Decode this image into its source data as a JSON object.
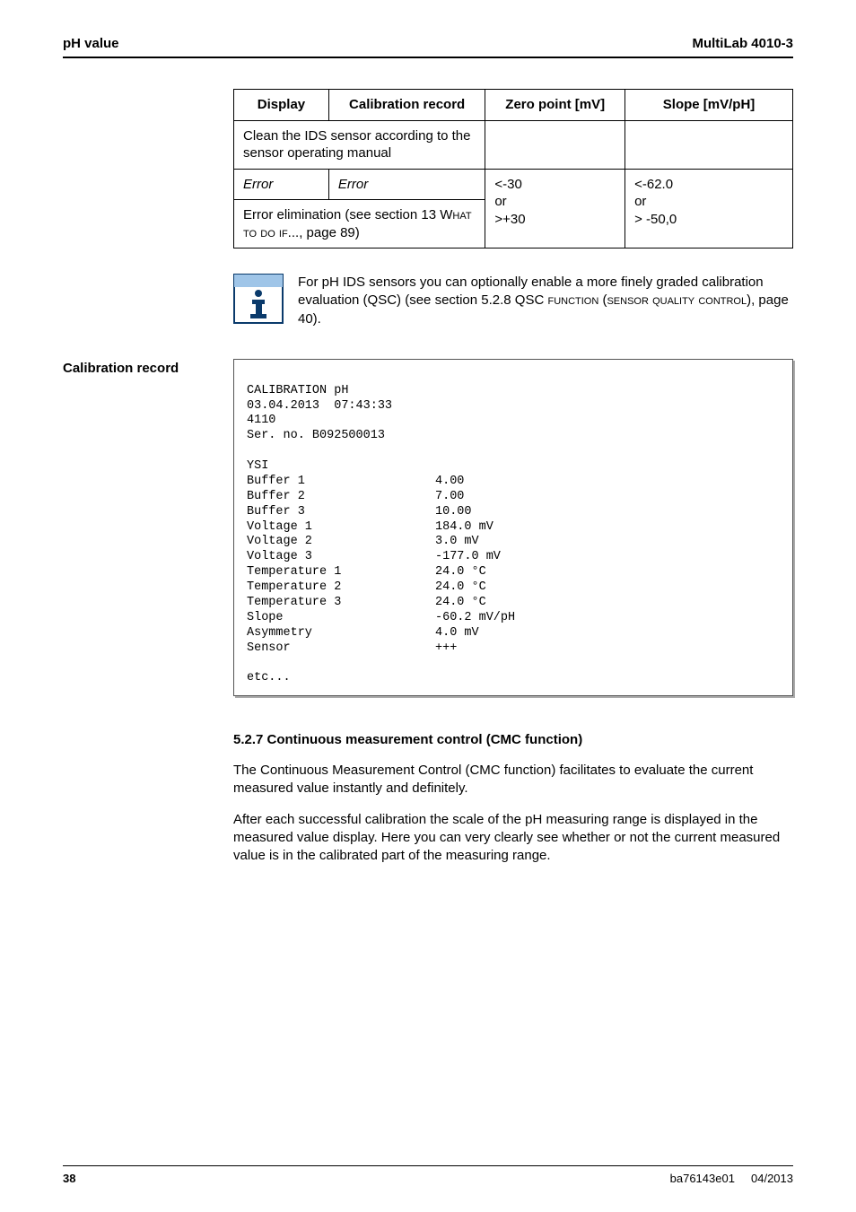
{
  "header": {
    "left": "pH value",
    "right": "MultiLab 4010-3"
  },
  "table": {
    "headers": [
      "Display",
      "Calibration record",
      "Zero point [mV]",
      "Slope [mV/pH]"
    ],
    "row_clean": "Clean the IDS sensor according to the sensor operating manual",
    "row_error_c1": "Error",
    "row_error_c2": "Error",
    "row_error_c3": "<-30\nor\n>+30",
    "row_error_c4": "<-62.0\nor\n> -50,0",
    "row_elim_pre": "Error elimination (see section 13 ",
    "row_elim_sc": "What to do if...",
    "row_elim_post": ", page 89)"
  },
  "info": {
    "line1": "For pH IDS sensors you can optionally enable a more finely graded calibration evaluation (QSC) (see section 5.2.8 QSC ",
    "sc1": "function (sensor quality control)",
    "line2": ", page 40)."
  },
  "side_label": "Calibration record",
  "record": {
    "head1": "CALIBRATION pH",
    "head2": "03.04.2013  07:43:33",
    "head3": "4110",
    "head4": "Ser. no. B092500013",
    "rows": [
      [
        "YSI",
        ""
      ],
      [
        "Buffer 1",
        "4.00"
      ],
      [
        "Buffer 2",
        "7.00"
      ],
      [
        "Buffer 3",
        "10.00"
      ],
      [
        "Voltage 1",
        "184.0 mV"
      ],
      [
        "Voltage 2",
        "3.0 mV"
      ],
      [
        "Voltage 3",
        "-177.0 mV"
      ],
      [
        "Temperature 1",
        "24.0 °C"
      ],
      [
        "Temperature 2",
        "24.0 °C"
      ],
      [
        "Temperature 3",
        "24.0 °C"
      ],
      [
        "Slope",
        "-60.2 mV/pH"
      ],
      [
        "Asymmetry",
        "4.0 mV"
      ],
      [
        "Sensor",
        "+++"
      ]
    ],
    "etc": "etc..."
  },
  "subsection": {
    "title": "5.2.7   Continuous measurement control (CMC function)",
    "p1": "The Continuous Measurement Control (CMC function) facilitates to evaluate the current measured value instantly and definitely.",
    "p2": "After each successful calibration the scale of the pH measuring range is displayed in the measured value display. Here you can very clearly see whether or not the current measured value is in the calibrated part of the measuring range."
  },
  "footer": {
    "page": "38",
    "doc": "ba76143e01",
    "date": "04/2013"
  }
}
